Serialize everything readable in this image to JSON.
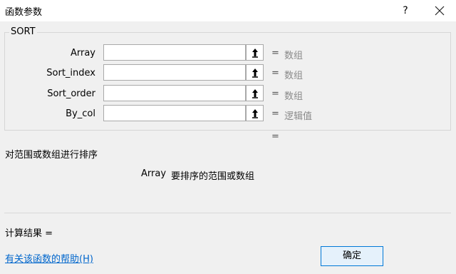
{
  "window": {
    "title": "函数参数",
    "help_label": "?"
  },
  "group": {
    "legend": "SORT"
  },
  "arguments": [
    {
      "label": "Array",
      "value": "",
      "equals": "=",
      "hint": "数组"
    },
    {
      "label": "Sort_index",
      "value": "",
      "equals": "=",
      "hint": "数组"
    },
    {
      "label": "Sort_order",
      "value": "",
      "equals": "=",
      "hint": "数组"
    },
    {
      "label": "By_col",
      "value": "",
      "equals": "=",
      "hint": "逻辑值"
    }
  ],
  "result_equals": "=",
  "function_description": "对范围或数组进行排序",
  "argument_help": {
    "name": "Array",
    "text": "要排序的范围或数组"
  },
  "calc_result_label": "计算结果 =",
  "help_link": "有关该函数的帮助(H)",
  "ok_label": "确定",
  "colors": {
    "link": "#0066cc",
    "hint": "#8a8a8a",
    "ok_border": "#0078d7"
  }
}
